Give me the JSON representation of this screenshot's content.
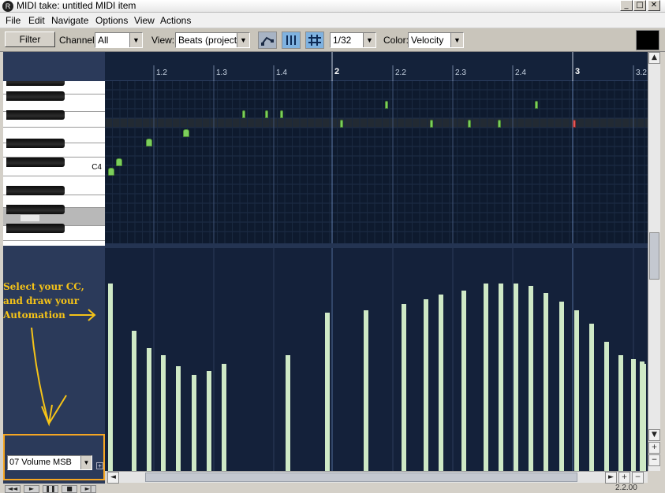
{
  "window": {
    "title": "MIDI take: untitled MIDI item",
    "controls": [
      "_",
      "□",
      "✕"
    ]
  },
  "menu": [
    "File",
    "Edit",
    "Navigate",
    "Options",
    "View",
    "Actions"
  ],
  "toolbar": {
    "filter_label": "Filter",
    "channel_label": "Channel:",
    "channel_value": "All",
    "view_label": "View:",
    "view_value": "Beats (project)",
    "grid_value": "1/32",
    "color_label": "Color:",
    "color_value": "Velocity",
    "icons": [
      "note-draw-icon",
      "quantize-icon",
      "grid-icon"
    ]
  },
  "timeline": {
    "ticks": [
      "1.2",
      "1.3",
      "1.4",
      "2",
      "2.2",
      "2.3",
      "2.4",
      "3",
      "3.2"
    ]
  },
  "keyboard": {
    "c4_label": "C4"
  },
  "annotation": {
    "lines": [
      "Select your CC,",
      "and draw your",
      "Automation"
    ]
  },
  "cc_lane": {
    "selected": "07 Volume MSB",
    "add_label": "+",
    "values": [
      84,
      63,
      55,
      52,
      47,
      43,
      45,
      48,
      52,
      71,
      72,
      75,
      77,
      79,
      81,
      84,
      84,
      84,
      83,
      80,
      76,
      72,
      66,
      58,
      52,
      50,
      49,
      48
    ]
  },
  "scroll": {
    "vertical_buttons": [
      "▲",
      "▼",
      "+",
      "−"
    ],
    "horizontal_buttons": [
      "◄",
      "►",
      "+",
      "−"
    ]
  },
  "status": {
    "transport": [
      "◄◄",
      "►",
      "❚❚",
      "■",
      "►|"
    ],
    "text": "2.2.00"
  },
  "colors": {
    "note": "#7ccf5c",
    "selected_note": "#e25a5a",
    "cc_bar": "#cfe9c6",
    "annotation": "#f5c318",
    "background": "#14213a"
  }
}
